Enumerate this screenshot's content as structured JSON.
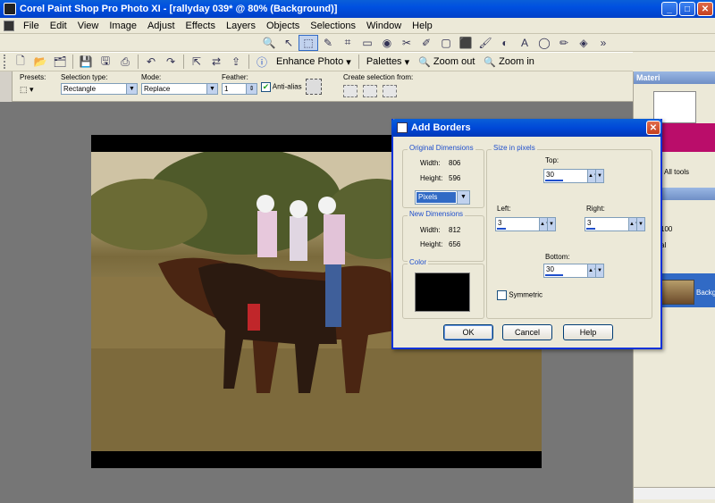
{
  "window": {
    "title": "Corel Paint Shop Pro Photo XI - [rallyday 039* @  80% (Background)]"
  },
  "menu": [
    "File",
    "Edit",
    "View",
    "Image",
    "Adjust",
    "Effects",
    "Layers",
    "Objects",
    "Selections",
    "Window",
    "Help"
  ],
  "toolbar": {
    "enhance_photo": "Enhance Photo",
    "palettes": "Palettes",
    "zoom_out": "Zoom out",
    "zoom_in": "Zoom in"
  },
  "tool_options": {
    "presets_label": "Presets:",
    "selection_type_label": "Selection type:",
    "selection_type_value": "Rectangle",
    "mode_label": "Mode:",
    "mode_value": "Replace",
    "feather_label": "Feather:",
    "feather_value": "1",
    "antialias_label": "Anti-alias",
    "antialias_checked": true,
    "create_selection_label": "Create selection from:"
  },
  "right_panel": {
    "materials_title": "Materi",
    "all_tools": "All tools",
    "opacity_value": "100",
    "blend_fragment": "al",
    "layer_name": "Backg"
  },
  "dialog": {
    "title": "Add Borders",
    "original_dimensions": {
      "title": "Original Dimensions",
      "width_label": "Width:",
      "width_value": "806",
      "height_label": "Height:",
      "height_value": "596"
    },
    "units_value": "Pixels",
    "new_dimensions": {
      "title": "New Dimensions",
      "width_label": "Width:",
      "width_value": "812",
      "height_label": "Height:",
      "height_value": "656"
    },
    "color_title": "Color",
    "border_color": "#000000",
    "size_title": "Size in pixels",
    "top_label": "Top:",
    "top_value": "30",
    "left_label": "Left:",
    "left_value": "3",
    "right_label": "Right:",
    "right_value": "3",
    "bottom_label": "Bottom:",
    "bottom_value": "30",
    "symmetric_label": "Symmetric",
    "symmetric_checked": false,
    "ok_label": "OK",
    "cancel_label": "Cancel",
    "help_label": "Help"
  },
  "colors": {
    "titlebar_blue": "#0a5fd8",
    "workspace_gray": "#767676",
    "magenta_swatch": "#ba0d6a"
  }
}
